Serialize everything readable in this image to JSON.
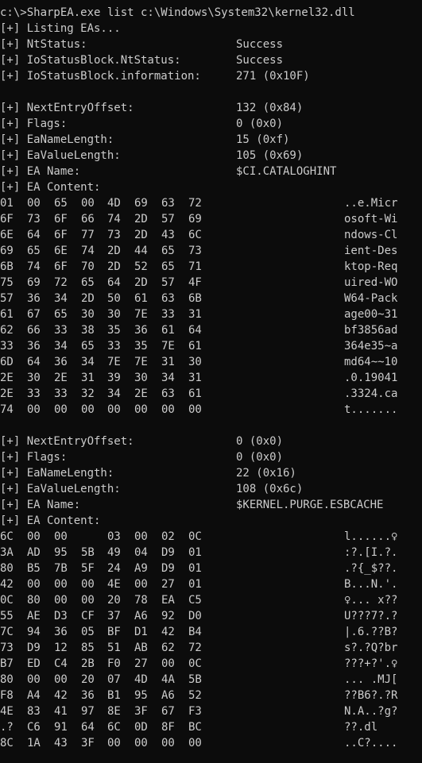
{
  "command": "c:\\>SharpEA.exe list c:\\Windows\\System32\\kernel32.dll",
  "header_lines": [
    {
      "label": "[+] Listing EAs...",
      "value": ""
    },
    {
      "label": "[+] NtStatus:",
      "value": "Success"
    },
    {
      "label": "[+] IoStatusBlock.NtStatus:",
      "value": "Success"
    },
    {
      "label": "[+] IoStatusBlock.information:",
      "value": "271 (0x10F)"
    }
  ],
  "entries": [
    {
      "fields": [
        {
          "label": "[+] NextEntryOffset:",
          "value": "132 (0x84)"
        },
        {
          "label": "[+] Flags:",
          "value": "0 (0x0)"
        },
        {
          "label": "[+] EaNameLength:",
          "value": "15 (0xf)"
        },
        {
          "label": "[+] EaValueLength:",
          "value": "105 (0x69)"
        },
        {
          "label": "[+] EA Name:",
          "value": "$CI.CATALOGHINT"
        }
      ],
      "content_label": "[+] EA Content:",
      "rows": [
        {
          "hex": [
            "01",
            "00",
            "65",
            "00",
            "4D",
            "69",
            "63",
            "72"
          ],
          "ascii": "..e.Micr"
        },
        {
          "hex": [
            "6F",
            "73",
            "6F",
            "66",
            "74",
            "2D",
            "57",
            "69"
          ],
          "ascii": "osoft-Wi"
        },
        {
          "hex": [
            "6E",
            "64",
            "6F",
            "77",
            "73",
            "2D",
            "43",
            "6C"
          ],
          "ascii": "ndows-Cl"
        },
        {
          "hex": [
            "69",
            "65",
            "6E",
            "74",
            "2D",
            "44",
            "65",
            "73"
          ],
          "ascii": "ient-Des"
        },
        {
          "hex": [
            "6B",
            "74",
            "6F",
            "70",
            "2D",
            "52",
            "65",
            "71"
          ],
          "ascii": "ktop-Req"
        },
        {
          "hex": [
            "75",
            "69",
            "72",
            "65",
            "64",
            "2D",
            "57",
            "4F"
          ],
          "ascii": "uired-WO"
        },
        {
          "hex": [
            "57",
            "36",
            "34",
            "2D",
            "50",
            "61",
            "63",
            "6B"
          ],
          "ascii": "W64-Pack"
        },
        {
          "hex": [
            "61",
            "67",
            "65",
            "30",
            "30",
            "7E",
            "33",
            "31"
          ],
          "ascii": "age00~31"
        },
        {
          "hex": [
            "62",
            "66",
            "33",
            "38",
            "35",
            "36",
            "61",
            "64"
          ],
          "ascii": "bf3856ad"
        },
        {
          "hex": [
            "33",
            "36",
            "34",
            "65",
            "33",
            "35",
            "7E",
            "61"
          ],
          "ascii": "364e35~a"
        },
        {
          "hex": [
            "6D",
            "64",
            "36",
            "34",
            "7E",
            "7E",
            "31",
            "30"
          ],
          "ascii": "md64~~10"
        },
        {
          "hex": [
            "2E",
            "30",
            "2E",
            "31",
            "39",
            "30",
            "34",
            "31"
          ],
          "ascii": ".0.19041"
        },
        {
          "hex": [
            "2E",
            "33",
            "33",
            "32",
            "34",
            "2E",
            "63",
            "61"
          ],
          "ascii": ".3324.ca"
        },
        {
          "hex": [
            "74",
            "00",
            "00",
            "00",
            "00",
            "00",
            "00",
            "00"
          ],
          "ascii": "t......."
        }
      ]
    },
    {
      "fields": [
        {
          "label": "[+] NextEntryOffset:",
          "value": "0 (0x0)"
        },
        {
          "label": "[+] Flags:",
          "value": "0 (0x0)"
        },
        {
          "label": "[+] EaNameLength:",
          "value": "22 (0x16)"
        },
        {
          "label": "[+] EaValueLength:",
          "value": "108 (0x6c)"
        },
        {
          "label": "[+] EA Name:",
          "value": "$KERNEL.PURGE.ESBCACHE"
        }
      ],
      "content_label": "[+] EA Content:",
      "rows": [
        {
          "hex": [
            "6C",
            "00",
            "00",
            "03",
            "00",
            "02",
            "0C"
          ],
          "ascii": "l......♀"
        },
        {
          "hex": [
            "3A",
            "AD",
            "95",
            "5B",
            "49",
            "04",
            "D9",
            "01"
          ],
          "ascii": ":?.[I.?."
        },
        {
          "hex": [
            "80",
            "B5",
            "7B",
            "5F",
            "24",
            "A9",
            "D9",
            "01"
          ],
          "ascii": ".?{_$??."
        },
        {
          "hex": [
            "42",
            "00",
            "00",
            "00",
            "4E",
            "00",
            "27",
            "01"
          ],
          "ascii": "B...N.'."
        },
        {
          "hex": [
            "0C",
            "80",
            "00",
            "00",
            "20",
            "78",
            "EA",
            "C5"
          ],
          "ascii": "♀... x??"
        },
        {
          "hex": [
            "55",
            "AE",
            "D3",
            "CF",
            "37",
            "A6",
            "92",
            "D0"
          ],
          "ascii": "U???7?.?"
        },
        {
          "hex": [
            "7C",
            "94",
            "36",
            "05",
            "BF",
            "D1",
            "42",
            "B4"
          ],
          "ascii": "|.6.??B?"
        },
        {
          "hex": [
            "73",
            "D9",
            "12",
            "85",
            "51",
            "AB",
            "62",
            "72"
          ],
          "ascii": "s?.?Q?br"
        },
        {
          "hex": [
            "B7",
            "ED",
            "C4",
            "2B",
            "F0",
            "27",
            "00",
            "0C"
          ],
          "ascii": "???+?'.♀"
        },
        {
          "hex": [
            "80",
            "00",
            "00",
            "20",
            "07",
            "4D",
            "4A",
            "5B"
          ],
          "ascii": "... .MJ["
        },
        {
          "hex": [
            "F8",
            "A4",
            "42",
            "36",
            "B1",
            "95",
            "A6",
            "52"
          ],
          "ascii": "??B6?.?R"
        },
        {
          "hex": [
            "4E",
            "83",
            "41",
            "97",
            "8E",
            "3F",
            "67",
            "F3"
          ],
          "ascii": "N.A..?g?"
        },
        {
          "hex": [
            ".?",
            "C6",
            "91",
            "64",
            "6C",
            "0D",
            "8F",
            "BC"
          ],
          "ascii": "??.dl"
        },
        {
          "hex": [
            "8C",
            "1A",
            "43",
            "3F",
            "00",
            "00",
            "00",
            "00"
          ],
          "ascii": "..C?...."
        }
      ]
    }
  ]
}
